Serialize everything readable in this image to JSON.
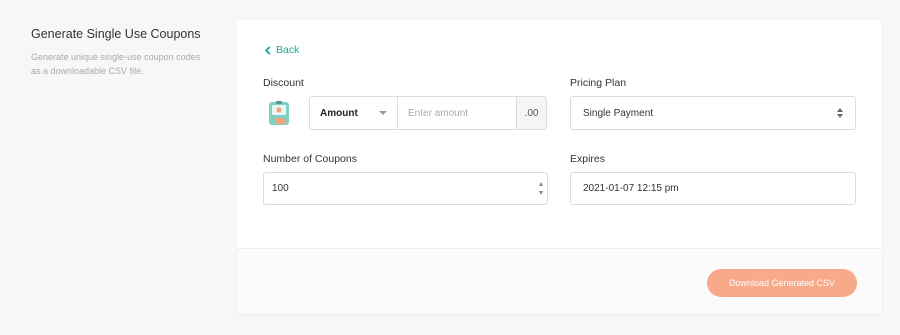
{
  "section": {
    "title": "Generate Single Use Coupons",
    "description": "Generate unique single-use coupon codes as a downloadable CSV file."
  },
  "form": {
    "back_label": "Back",
    "discount": {
      "label": "Discount",
      "type_value": "Amount",
      "amount_placeholder": "Enter amount",
      "suffix": ".00"
    },
    "pricing_plan": {
      "label": "Pricing Plan",
      "value": "Single Payment"
    },
    "num_coupons": {
      "label": "Number of Coupons",
      "value": "100"
    },
    "expires": {
      "label": "Expires",
      "value": "2021-01-07 12:15 pm"
    },
    "download_label": "Download Generated CSV"
  },
  "colors": {
    "accent": "#1ea896",
    "button": "#f8a98a"
  }
}
